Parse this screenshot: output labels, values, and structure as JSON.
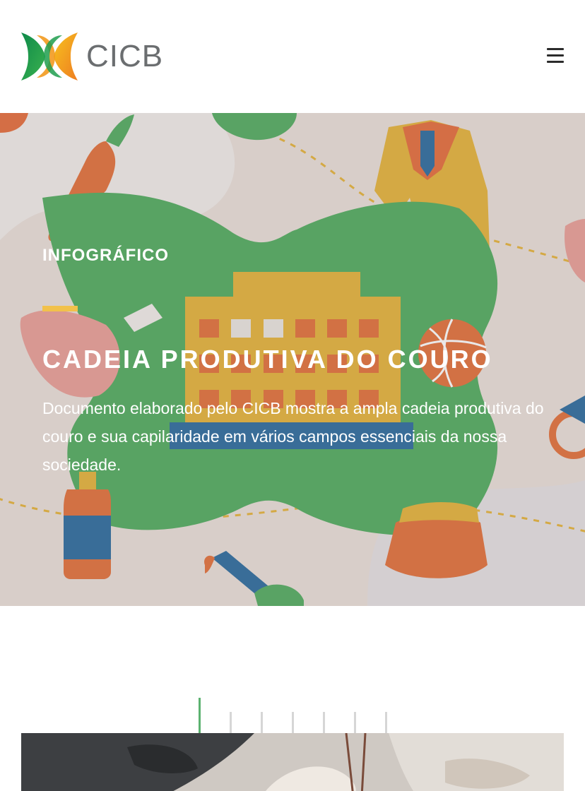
{
  "header": {
    "logo_text": "CICB",
    "logo_icon": "cicb-logo-icon",
    "menu_icon": "hamburger-menu-icon"
  },
  "hero": {
    "eyebrow": "INFOGRÁFICO",
    "title": "CADEIA PRODUTIVA DO COURO",
    "description": "Documento elaborado pelo CICB mostra a ampla cadeia produtiva do couro e sua capilaridade em vários campos essenciais da nossa sociedade.",
    "accent_color": "#f2c14b"
  },
  "slider": {
    "count": 7,
    "active_index": 0,
    "active_color": "#5cb270",
    "inactive_color": "#d6d6d6"
  },
  "colors": {
    "brand_green": "#1e9a4f",
    "brand_yellow": "#f5b81c",
    "brand_orange": "#ef8b22",
    "logo_gray": "#6b6e70"
  }
}
